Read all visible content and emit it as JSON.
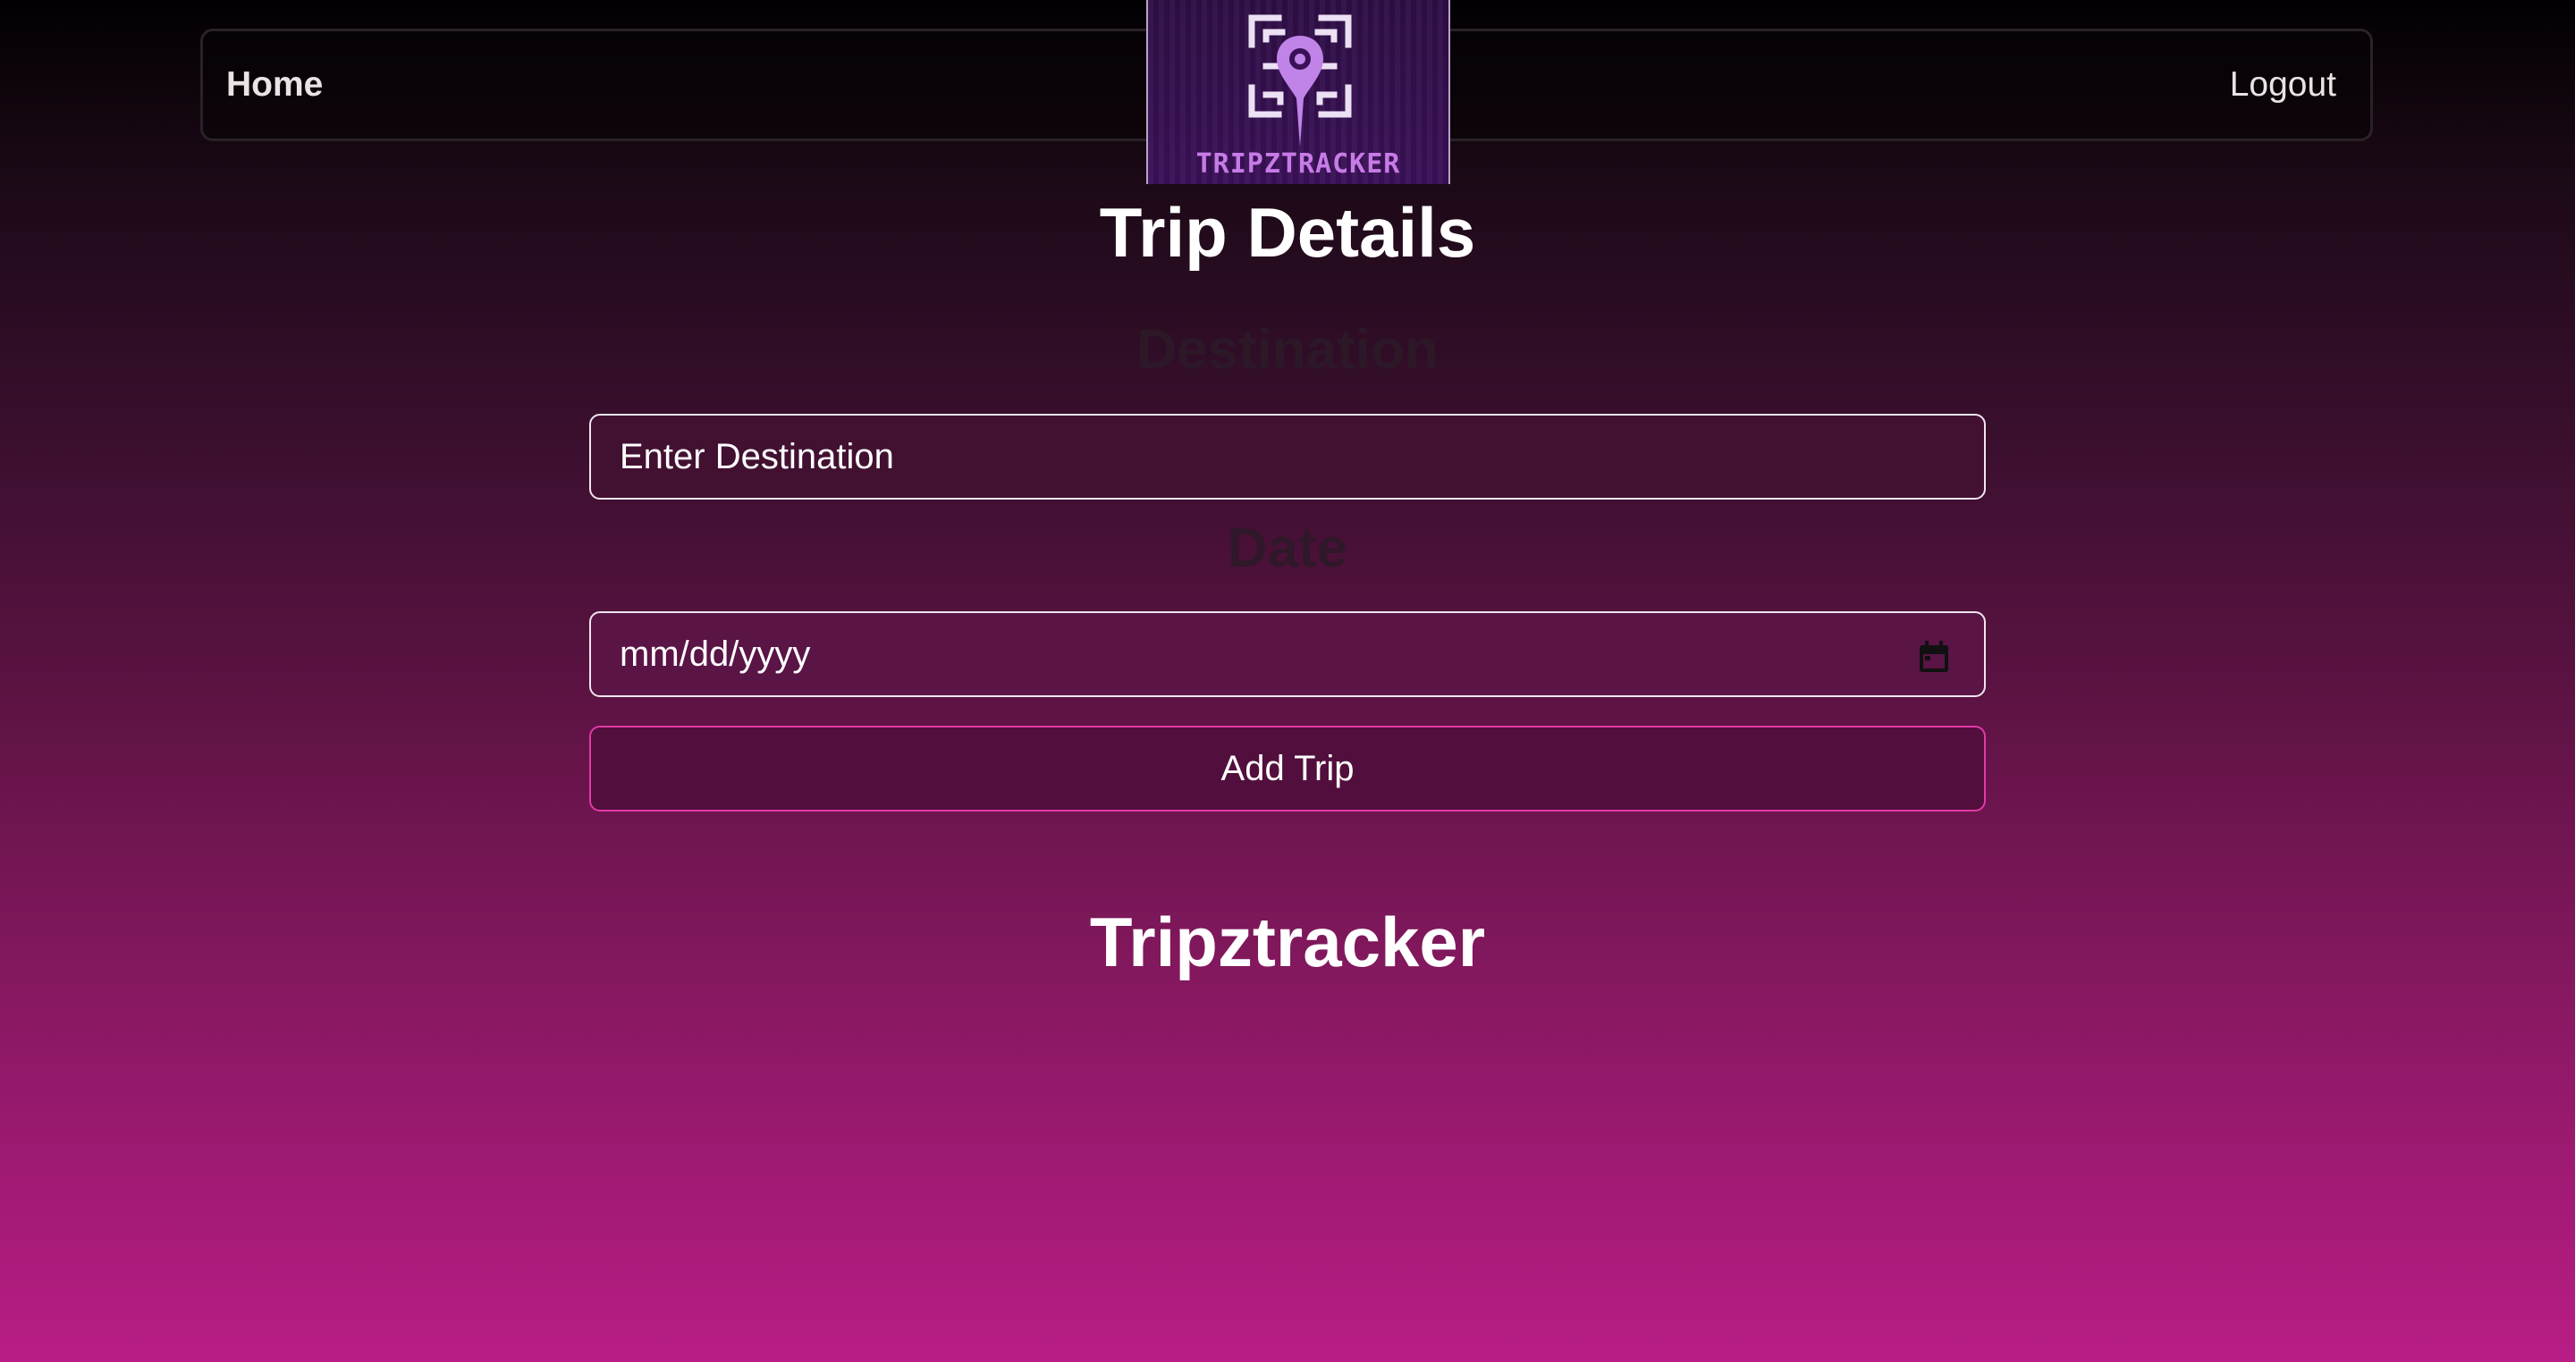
{
  "nav": {
    "home_label": "Home",
    "logout_label": "Logout"
  },
  "logo": {
    "text": "TRIPZTRACKER",
    "icon": "map-pin-circuit-icon",
    "accent_color": "#c77be6"
  },
  "form": {
    "title": "Trip Details",
    "destination_label": "Destination",
    "destination_placeholder": "Enter Destination",
    "date_label": "Date",
    "date_placeholder": "mm/dd/yyyy",
    "date_icon": "calendar-icon",
    "submit_label": "Add Trip"
  },
  "footer": {
    "title": "Tripztracker"
  },
  "colors": {
    "background_top": "#020002",
    "background_bottom": "#b81d85",
    "button_border": "#e23aa6"
  }
}
